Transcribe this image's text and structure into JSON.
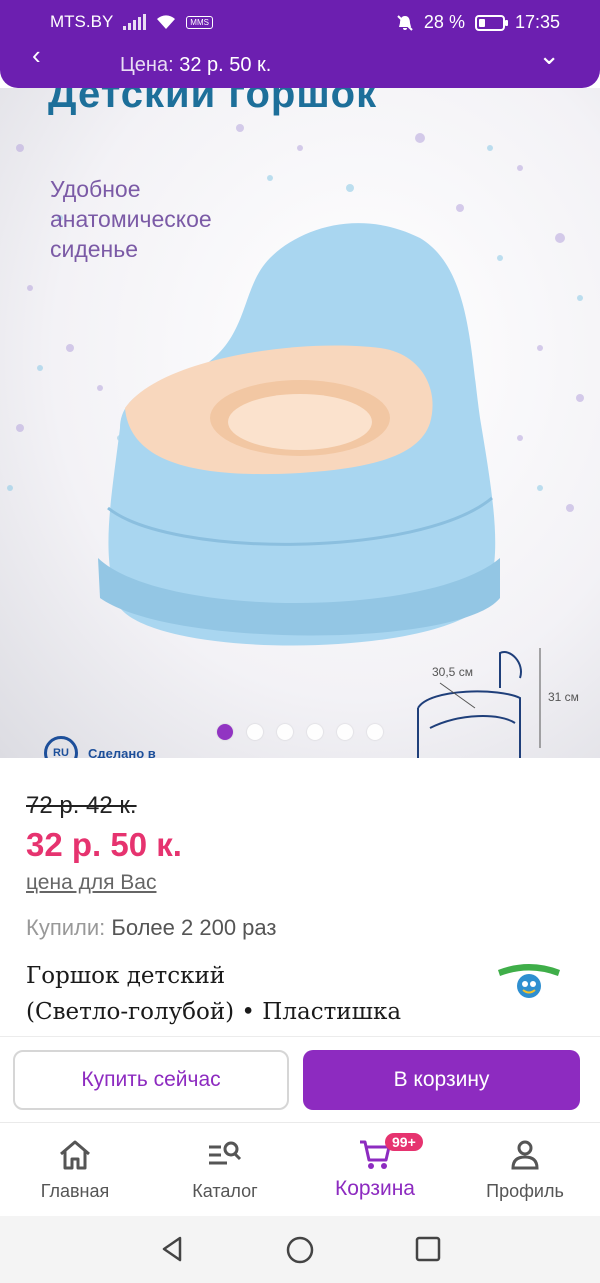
{
  "status_bar": {
    "carrier": "MTS.BY",
    "mms": "MMS",
    "battery": "28 %",
    "battery_level": 0.28,
    "time": "17:35"
  },
  "topbar": {
    "price_label": "Цена:",
    "price_value": "32 р. 50 к."
  },
  "hero": {
    "title": "Детский горшок",
    "subtitle": "Удобное анатомическое сиденье",
    "dim_width": "30,5 см",
    "dim_height": "31 см",
    "made_in_badge": "RU",
    "made_in_text": "Сделано в",
    "carousel": {
      "count": 6,
      "active": 0
    }
  },
  "product": {
    "old_price": "72 р. 42 к.",
    "new_price": "32 р. 50 к.",
    "for_you": "цена для Вас",
    "bought_label": "Купили:",
    "bought_value": "Более 2 200 раз",
    "name_line1": "Горшок детский",
    "name_line2": "(Светло-голубой) • Пластишка",
    "brand_logo": "ПЛАСТИШКА"
  },
  "actions": {
    "buy_now": "Купить сейчас",
    "add_to_cart": "В корзину"
  },
  "bottom_nav": {
    "items": [
      {
        "label": "Главная",
        "icon": "home-icon"
      },
      {
        "label": "Каталог",
        "icon": "catalog-search-icon"
      },
      {
        "label": "Корзина",
        "icon": "cart-icon",
        "badge": "99+"
      },
      {
        "label": "Профиль",
        "icon": "profile-icon"
      }
    ],
    "active": 2
  },
  "colors": {
    "brand": "#6c1fb0",
    "accent": "#8d2bc0",
    "price": "#e6336f"
  }
}
